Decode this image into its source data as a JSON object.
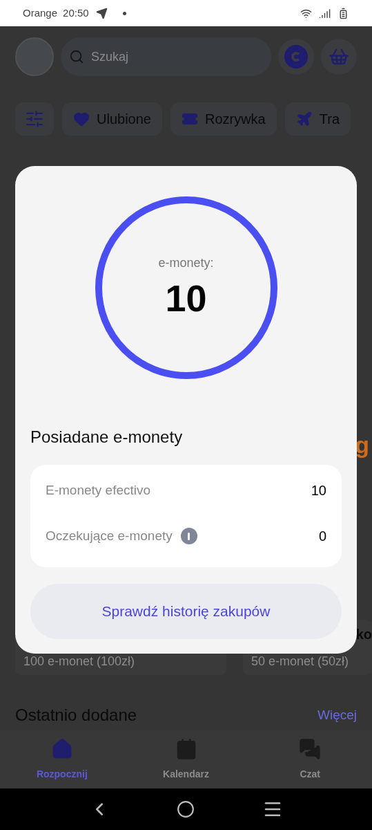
{
  "status_bar": {
    "carrier": "Orange",
    "time": "20:50"
  },
  "header": {
    "search": {
      "placeholder": "Szukaj"
    }
  },
  "chips": [
    {
      "label": "Ulubione",
      "kind": "heart"
    },
    {
      "label": "Rozrywka",
      "kind": "ticket"
    },
    {
      "label": "Tra",
      "kind": "plane"
    }
  ],
  "promo": {
    "text": "g"
  },
  "offers": [
    {
      "subtitle": "100 e-monet (100zł)"
    },
    {
      "title": "ko",
      "subtitle": "50 e-monet (50zł)"
    }
  ],
  "recent": {
    "title": "Ostatnio dodane",
    "link": "Więcej"
  },
  "bottom_nav": [
    {
      "label": "Rozpocznij",
      "kind": "home",
      "selected": true
    },
    {
      "label": "Kalendarz",
      "kind": "calendar",
      "selected": false
    },
    {
      "label": "Czat",
      "kind": "chat",
      "selected": false
    }
  ],
  "modal": {
    "balance_label": "e-monety:",
    "balance": "10",
    "section_title": "Posiadane e-monety",
    "rows": [
      {
        "label": "E-monety efectivo",
        "value": "10",
        "info": false
      },
      {
        "label": "Oczekujące e-monety",
        "value": "0",
        "info": true
      }
    ],
    "button": "Sprawdź historię zakupów"
  }
}
